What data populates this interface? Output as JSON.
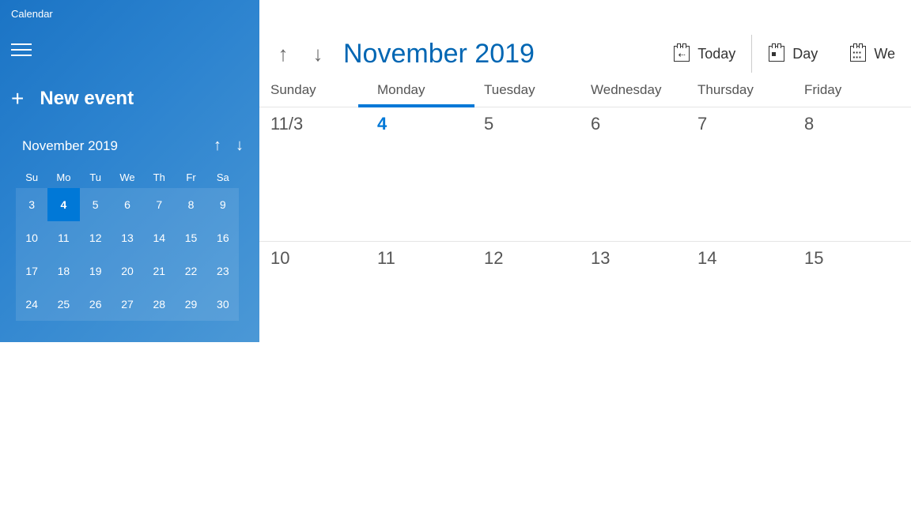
{
  "app": {
    "title": "Calendar"
  },
  "sidebar": {
    "new_event_label": "New event",
    "mini": {
      "title": "November 2019",
      "day_headers": [
        "Su",
        "Mo",
        "Tu",
        "We",
        "Th",
        "Fr",
        "Sa"
      ],
      "weeks": [
        [
          "3",
          "4",
          "5",
          "6",
          "7",
          "8",
          "9"
        ],
        [
          "10",
          "11",
          "12",
          "13",
          "14",
          "15",
          "16"
        ],
        [
          "17",
          "18",
          "19",
          "20",
          "21",
          "22",
          "23"
        ],
        [
          "24",
          "25",
          "26",
          "27",
          "28",
          "29",
          "30"
        ]
      ],
      "today": "4"
    }
  },
  "main": {
    "month_title": "November 2019",
    "view_today": "Today",
    "view_day": "Day",
    "view_week": "We",
    "weekdays": [
      "Sunday",
      "Monday",
      "Tuesday",
      "Wednesday",
      "Thursday",
      "Friday"
    ],
    "today_weekday_index": 1,
    "rows": [
      [
        "11/3",
        "4",
        "5",
        "6",
        "7",
        "8"
      ],
      [
        "10",
        "11",
        "12",
        "13",
        "14",
        "15"
      ]
    ],
    "today_cell": "4"
  }
}
